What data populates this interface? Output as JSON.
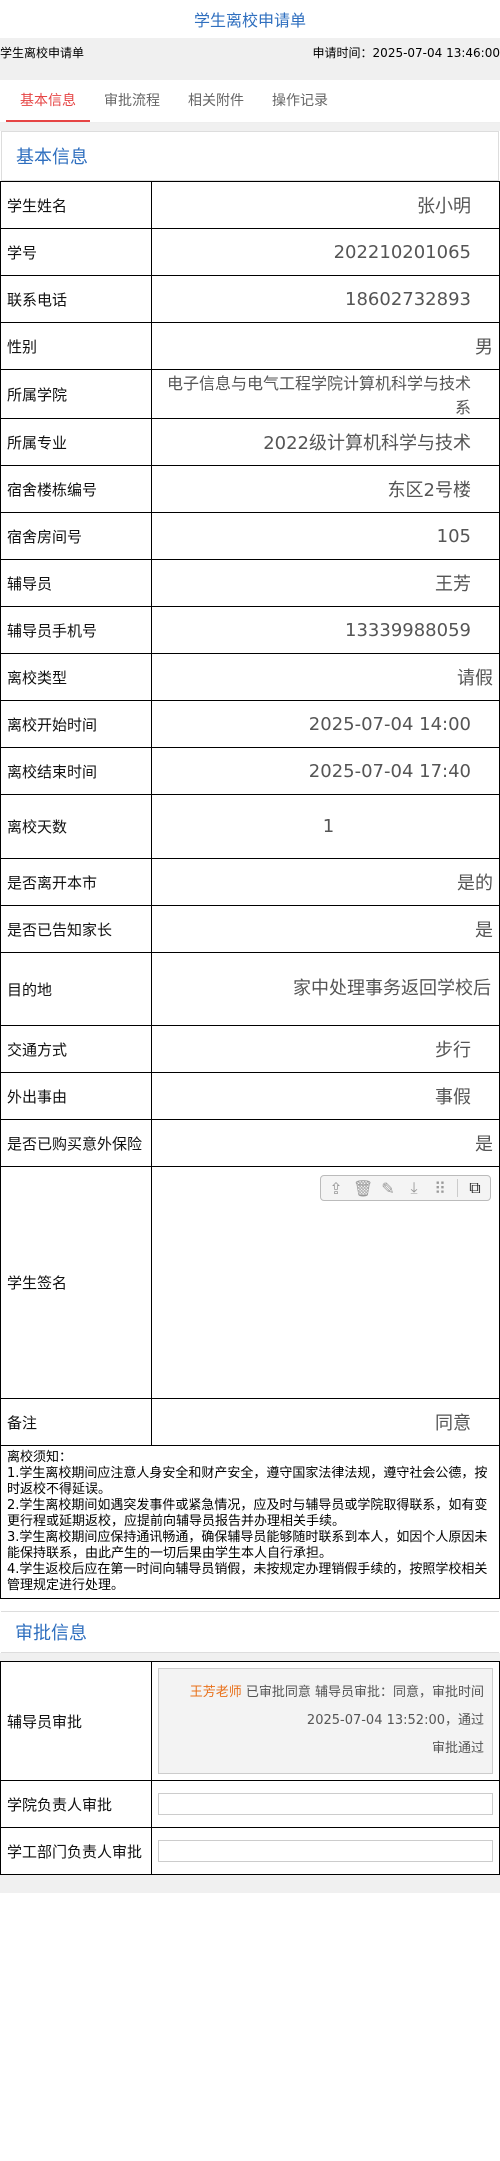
{
  "app": {
    "title": "学生离校申请单"
  },
  "meta": {
    "left": "学生离校申请单",
    "right": "申请时间：2025-07-04 13:46:00"
  },
  "tabs": [
    "基本信息",
    "审批流程",
    "相关附件",
    "操作记录"
  ],
  "section1": {
    "title": "基本信息"
  },
  "fields": [
    {
      "label": "学生姓名",
      "value": "张小明"
    },
    {
      "label": "学号",
      "value": "202210201065"
    },
    {
      "label": "联系电话",
      "value": "18602732893"
    },
    {
      "label": "性别",
      "value": "男"
    },
    {
      "label": "所属学院",
      "value": "电子信息与电气工程学院计算机科学与技术系"
    },
    {
      "label": "所属专业",
      "value": "2022级计算机科学与技术"
    },
    {
      "label": "宿舍楼栋编号",
      "value": "东区2号楼"
    },
    {
      "label": "宿舍房间号",
      "value": "105"
    },
    {
      "label": "辅导员",
      "value": "王芳"
    },
    {
      "label": "辅导员手机号",
      "value": "13339988059"
    },
    {
      "label": "离校类型",
      "value": "请假"
    },
    {
      "label": "离校开始时间",
      "value": "2025-07-04 14:00"
    },
    {
      "label": "离校结束时间",
      "value": "2025-07-04 17:40"
    },
    {
      "label": "离校天数",
      "value": "1"
    },
    {
      "label": "是否离开本市",
      "value": "是的"
    },
    {
      "label": "是否已告知家长",
      "value": "是"
    },
    {
      "label": "目的地",
      "value": "家中处理事务返回学校后"
    },
    {
      "label": "交通方式",
      "value": "步行"
    },
    {
      "label": "外出事由",
      "value": "事假"
    },
    {
      "label": "是否已购买意外保险",
      "value": "是"
    }
  ],
  "signature": {
    "label": "学生签名",
    "toolbar_icons": [
      "upload-icon",
      "trash-icon",
      "edit-icon",
      "download-icon",
      "drag-handle-icon",
      "external-link-icon"
    ]
  },
  "remark": {
    "label": "备注",
    "value": "同意"
  },
  "notes": {
    "title": "离校须知：",
    "items": [
      "1.学生离校期间应注意人身安全和财产安全，遵守国家法律法规，遵守社会公德，按时返校不得延误。",
      "2.学生离校期间如遇突发事件或紧急情况，应及时与辅导员或学院取得联系，如有变更行程或延期返校，应提前向辅导员报告并办理相关手续。",
      "3.学生离校期间应保持通讯畅通，确保辅导员能够随时联系到本人，如因个人原因未能保持联系，由此产生的一切后果由学生本人自行承担。",
      "4.学生返校后应在第一时间向辅导员销假，未按规定办理销假手续的，按照学校相关管理规定进行处理。"
    ]
  },
  "section2": {
    "title": "审批信息"
  },
  "approval": {
    "row1": {
      "label": "辅导员审批",
      "approver": "王芳老师",
      "text": "已审批同意 辅导员审批：同意，审批时间 2025-07-04 13:52:00，通过",
      "status": "审批通过"
    },
    "row2": {
      "label": "学院负责人审批",
      "value": ""
    },
    "row3": {
      "label": "学工部门负责人审批",
      "value": ""
    }
  }
}
